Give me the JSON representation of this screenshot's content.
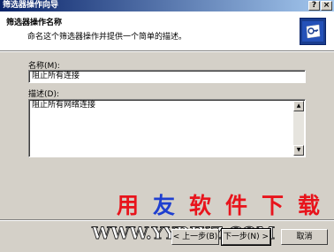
{
  "window": {
    "title": "筛选器操作向导",
    "help_label": "?",
    "close_label": "×"
  },
  "header": {
    "title": "筛选器操作名称",
    "description": "命名这个筛选器操作并提供一个简单的描述。",
    "icon": "wizard-key-icon"
  },
  "form": {
    "name_label": "名称(M):",
    "name_value": "阻止所有连接",
    "desc_label": "描述(D):",
    "desc_value": "阻止所有网络连接"
  },
  "watermark": {
    "text": "用友软件下载",
    "url": "WWW.YYRJXZ.COM",
    "colors": [
      "#e8141c",
      "#1f3fd0",
      "#e8141c",
      "#e8141c",
      "#e8141c",
      "#e8141c"
    ]
  },
  "buttons": {
    "back_label": "< 上一步(B)",
    "next_label": "下一步(N) >",
    "cancel_label": "取消"
  }
}
